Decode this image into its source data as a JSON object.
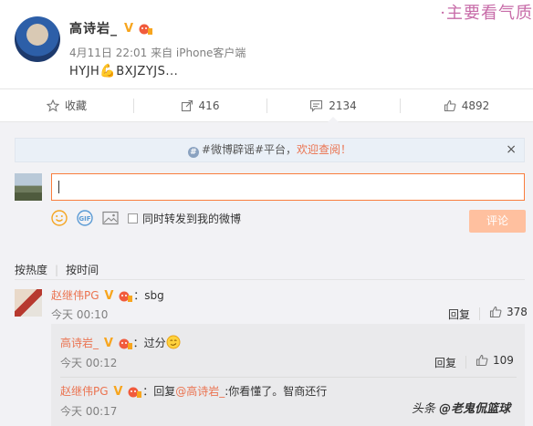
{
  "post": {
    "username": "高诗岩_",
    "meta": "4月11日 22:01 来自 iPhone客户端",
    "text_before": "HYJH",
    "emoji": "strong-arm-emoji",
    "text_after": "BXJZYJS...",
    "watermark": "·主要看气质"
  },
  "actions": [
    {
      "label": "收藏",
      "icon": "star-icon"
    },
    {
      "label": "416",
      "icon": "share-icon"
    },
    {
      "label": "2134",
      "icon": "comment-icon"
    },
    {
      "label": "4892",
      "icon": "like-icon"
    }
  ],
  "notice": {
    "prefix": "#微博辟谣#平台，",
    "highlight": "欢迎查阅！",
    "close": "×"
  },
  "composer": {
    "repost_label": "同时转发到我的微博",
    "submit_label": "评论"
  },
  "sort": {
    "hot": "按热度",
    "time": "按时间"
  },
  "comments": [
    {
      "name": "赵继伟PG",
      "text": "：sbg",
      "time": "今天 00:10",
      "reply": "回复",
      "likes": "378"
    }
  ],
  "replies": [
    {
      "name": "高诗岩_",
      "text": "：过分",
      "time": "今天 00:12",
      "reply": "回复",
      "likes": "109"
    },
    {
      "name": "赵继伟PG",
      "prefix": "：回复",
      "mention": "@高诗岩_",
      "text": ":你看懂了。智商还行",
      "time": "今天 00:17"
    }
  ],
  "footer": {
    "prefix": "头条 ",
    "handle": "@老鬼侃篮球"
  },
  "colors": {
    "accent": "#eb7350",
    "input_border": "#fa7d3c",
    "submit_bg": "#ffc09f"
  }
}
